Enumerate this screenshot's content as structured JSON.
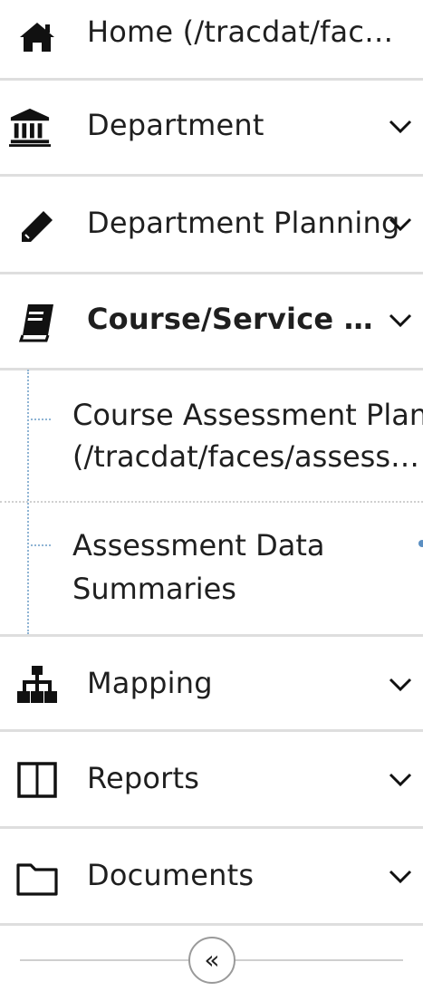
{
  "nav": {
    "items": [
      {
        "label": "Home (/tracdat/fac…",
        "icon": "home-icon"
      },
      {
        "label": "Department",
        "icon": "bank-icon"
      },
      {
        "label": "Department Planning",
        "icon": "pencil-icon"
      },
      {
        "label": "Course/Service …",
        "icon": "book-icon"
      },
      {
        "label": "Mapping",
        "icon": "sitemap-icon"
      },
      {
        "label": "Reports",
        "icon": "columns-icon"
      },
      {
        "label": "Documents",
        "icon": "folder-icon"
      }
    ],
    "subitems": [
      {
        "line1": "Course Assessment Plan",
        "line2": "(/tracdat/faces/assess…"
      },
      {
        "line1": "Assessment Data",
        "line2": "Summaries"
      }
    ]
  },
  "footer": {
    "collapse_glyph": "«"
  }
}
